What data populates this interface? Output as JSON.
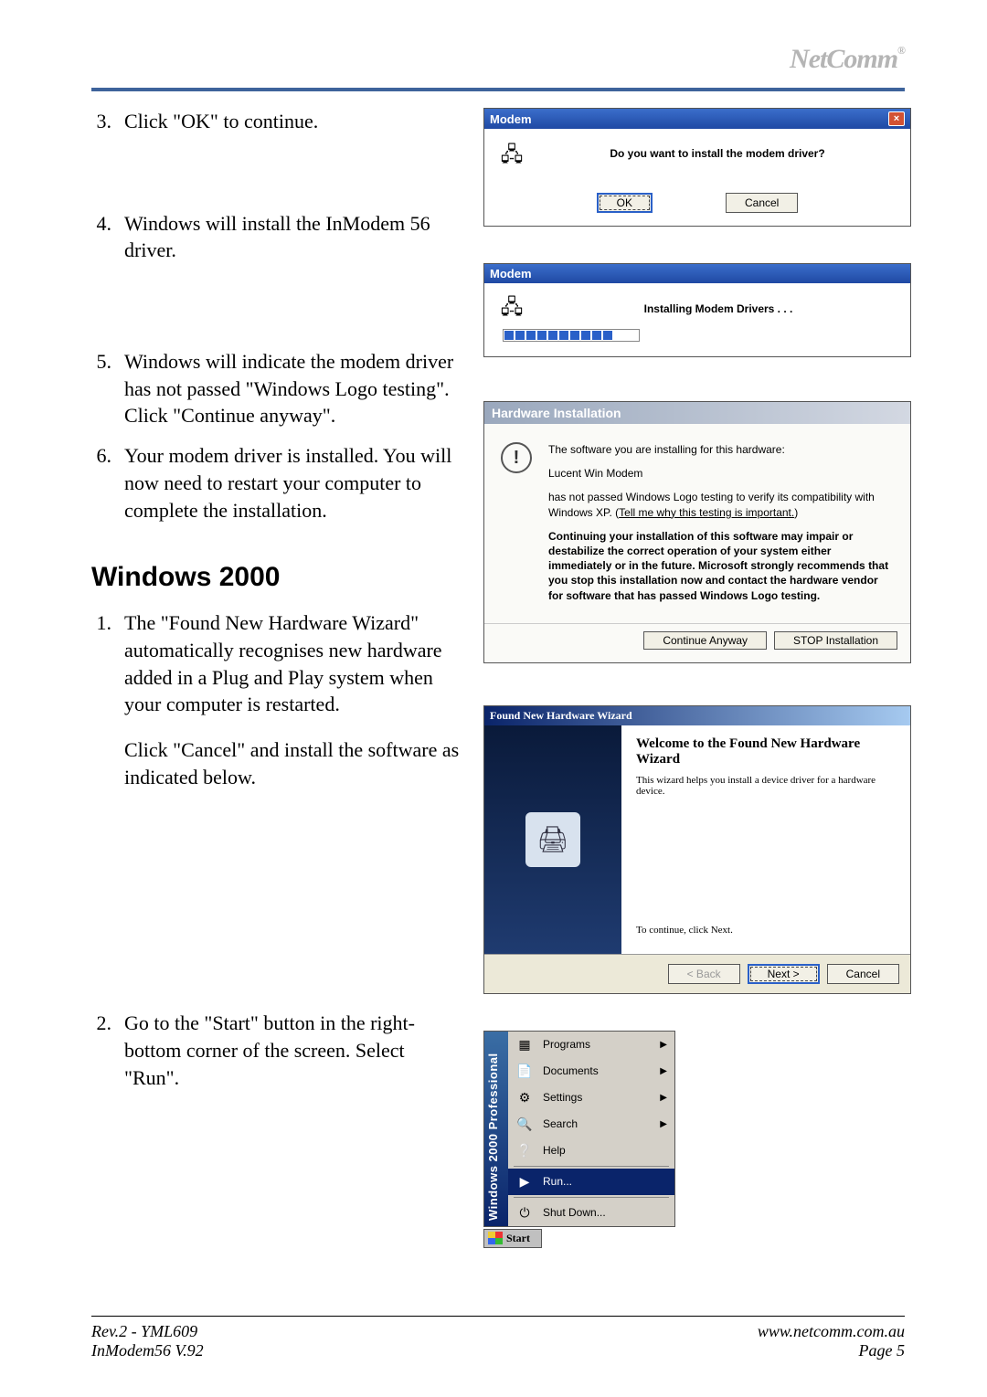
{
  "header": {
    "logo_text": "NetComm",
    "reg": "®"
  },
  "steps": {
    "s3": {
      "num": "3.",
      "text": "Click \"OK\" to continue."
    },
    "s4": {
      "num": "4.",
      "text": "Windows will install the InModem 56 driver."
    },
    "s5": {
      "num": "5.",
      "text": "Windows will indicate the modem driver has not passed \"Windows Logo testing\".  Click \"Continue anyway\"."
    },
    "s6": {
      "num": "6.",
      "text": "Your modem driver is installed.  You will now need to restart your computer to complete the installation."
    }
  },
  "section_title": "Windows 2000",
  "w2k": {
    "s1": {
      "num": "1.",
      "text": "The \"Found New Hardware Wizard\" automatically recognises new hardware added in a Plug and Play system when your computer is restarted.",
      "sub": "Click \"Cancel\" and install the software as indicated below."
    },
    "s2": {
      "num": "2.",
      "text": "Go to the \"Start\" button in the right-bottom corner of the screen.  Select \"Run\"."
    }
  },
  "dlg1": {
    "title": "Modem",
    "question": "Do you want to install the modem driver?",
    "ok": "OK",
    "cancel": "Cancel"
  },
  "dlg2": {
    "title": "Modem",
    "msg": "Installing Modem Drivers  . . ."
  },
  "hw": {
    "title": "Hardware Installation",
    "line1": "The software you are installing for this hardware:",
    "device": "Lucent Win Modem",
    "line2a": "has not passed Windows Logo testing to verify its compatibility with Windows XP. (",
    "link": "Tell me why this testing is important.",
    "line2b": ")",
    "bold": "Continuing your installation of this software may impair or destabilize the correct operation of your system either immediately or in the future. Microsoft strongly recommends that you stop this installation now and contact the hardware vendor for software that has passed Windows Logo testing.",
    "continue": "Continue Anyway",
    "stop": "STOP Installation"
  },
  "wizard": {
    "title": "Found New Hardware Wizard",
    "h": "Welcome to the Found New Hardware Wizard",
    "p1": "This wizard helps you install a device driver for a hardware device.",
    "p2": "To continue, click Next.",
    "back": "< Back",
    "next": "Next >",
    "cancel": "Cancel"
  },
  "startmenu": {
    "brand": "Windows 2000 Professional",
    "items": [
      {
        "label": "Programs",
        "arrow": true
      },
      {
        "label": "Documents",
        "arrow": true
      },
      {
        "label": "Settings",
        "arrow": true
      },
      {
        "label": "Search",
        "arrow": true
      },
      {
        "label": "Help",
        "arrow": false
      },
      {
        "label": "Run...",
        "arrow": false,
        "selected": true
      },
      {
        "label": "Shut Down...",
        "arrow": false
      }
    ],
    "start": "Start"
  },
  "footer": {
    "l1": "Rev.2 - YML609",
    "l2": "InModem56 V.92",
    "r1": "www.netcomm.com.au",
    "r2": "Page 5"
  }
}
